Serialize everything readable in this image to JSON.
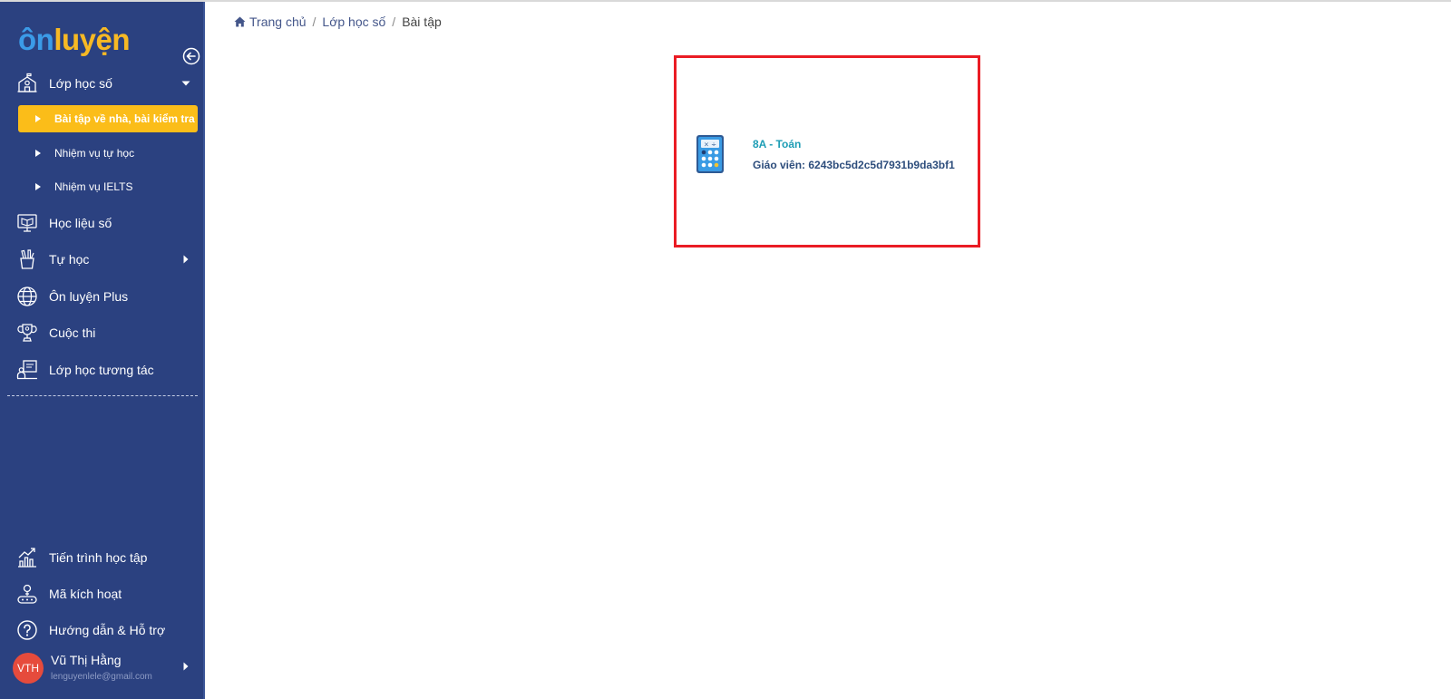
{
  "logo": {
    "part1": "ôn",
    "part2": "luyện"
  },
  "sidebar": {
    "menu": [
      {
        "label": "Lớp học số",
        "icon": "school-icon"
      },
      {
        "label": "Học liệu số",
        "icon": "monitor-book-icon"
      },
      {
        "label": "Tự học",
        "icon": "pencil-cup-icon"
      },
      {
        "label": "Ôn luyện Plus",
        "icon": "globe-icon"
      },
      {
        "label": "Cuộc thi",
        "icon": "trophy-icon"
      },
      {
        "label": "Lớp học tương tác",
        "icon": "interactive-class-icon"
      }
    ],
    "submenu": [
      {
        "label": "Bài tập về nhà, bài kiểm tra",
        "active": true
      },
      {
        "label": "Nhiệm vụ tự học",
        "active": false
      },
      {
        "label": "Nhiệm vụ IELTS",
        "active": false
      }
    ],
    "bottom_menu": [
      {
        "label": "Tiến trình học tập",
        "icon": "progress-chart-icon"
      },
      {
        "label": "Mã kích hoạt",
        "icon": "activation-code-icon"
      },
      {
        "label": "Hướng dẫn & Hỗ trợ",
        "icon": "help-icon"
      }
    ],
    "user": {
      "initials": "VTH",
      "name": "Vũ Thị Hằng",
      "email": "lenguyenlele@gmail.com"
    }
  },
  "breadcrumb": {
    "home": "Trang chủ",
    "level2": "Lớp học số",
    "current": "Bài tập"
  },
  "card": {
    "title": "8A - Toán",
    "teacher": "Giáo viên: 6243bc5d2c5d7931b9da3bf1",
    "icon": "calculator-icon"
  },
  "colors": {
    "sidebar_bg": "#2b4180",
    "active_item": "#fbbd19",
    "card_border": "#ea1c24",
    "card_title": "#1d9db5"
  }
}
